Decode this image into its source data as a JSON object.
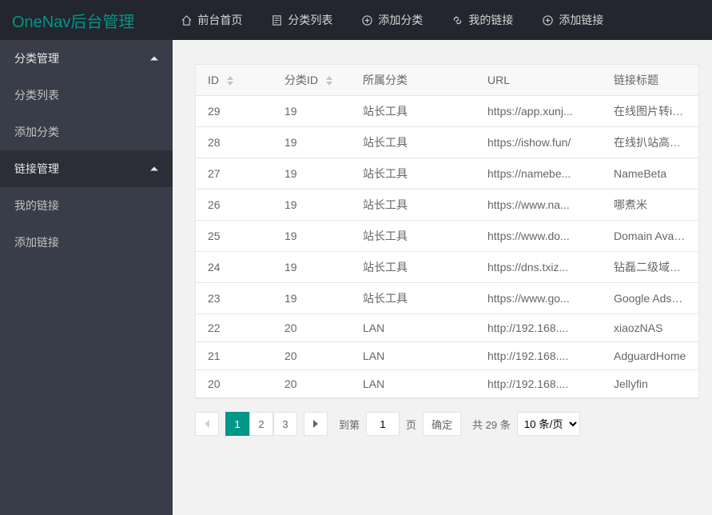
{
  "header": {
    "logo": "OneNav后台管理",
    "nav": [
      {
        "label": "前台首页",
        "icon": "home"
      },
      {
        "label": "分类列表",
        "icon": "doc"
      },
      {
        "label": "添加分类",
        "icon": "plus"
      },
      {
        "label": "我的链接",
        "icon": "link"
      },
      {
        "label": "添加链接",
        "icon": "plus"
      }
    ]
  },
  "sidebar": {
    "groups": [
      {
        "title": "分类管理",
        "items": [
          {
            "label": "分类列表"
          },
          {
            "label": "添加分类"
          }
        ]
      },
      {
        "title": "链接管理",
        "items": [
          {
            "label": "我的链接"
          },
          {
            "label": "添加链接"
          }
        ]
      }
    ]
  },
  "table": {
    "headers": {
      "id": "ID",
      "fid": "分类ID",
      "category": "所属分类",
      "url": "URL",
      "title": "链接标题"
    },
    "rows": [
      {
        "id": "29",
        "fid": "19",
        "cat": "站长工具",
        "url": "https://app.xunj...",
        "title": "在线图片转icon..."
      },
      {
        "id": "28",
        "fid": "19",
        "cat": "站长工具",
        "url": "https://ishow.fun/",
        "title": "在线扒站高级版"
      },
      {
        "id": "27",
        "fid": "19",
        "cat": "站长工具",
        "url": "https://namebe...",
        "title": "NameBeta"
      },
      {
        "id": "26",
        "fid": "19",
        "cat": "站长工具",
        "url": "https://www.na...",
        "title": "哪煮米"
      },
      {
        "id": "25",
        "fid": "19",
        "cat": "站长工具",
        "url": "https://www.do...",
        "title": "Domain Availa..."
      },
      {
        "id": "24",
        "fid": "19",
        "cat": "站长工具",
        "url": "https://dns.txiz...",
        "title": "钻磊二级域名..."
      },
      {
        "id": "23",
        "fid": "19",
        "cat": "站长工具",
        "url": "https://www.go...",
        "title": "Google Adsense"
      },
      {
        "id": "22",
        "fid": "20",
        "cat": "LAN",
        "url": "http://192.168....",
        "title": "xiaozNAS"
      },
      {
        "id": "21",
        "fid": "20",
        "cat": "LAN",
        "url": "http://192.168....",
        "title": "AdguardHome"
      },
      {
        "id": "20",
        "fid": "20",
        "cat": "LAN",
        "url": "http://192.168....",
        "title": "Jellyfin"
      }
    ]
  },
  "pager": {
    "pages": [
      "1",
      "2",
      "3"
    ],
    "active_page": "1",
    "jump_prefix": "到第",
    "jump_suffix": "页",
    "jump_value": "1",
    "confirm": "确定",
    "total": "共 29 条",
    "per_page": "10 条/页"
  }
}
